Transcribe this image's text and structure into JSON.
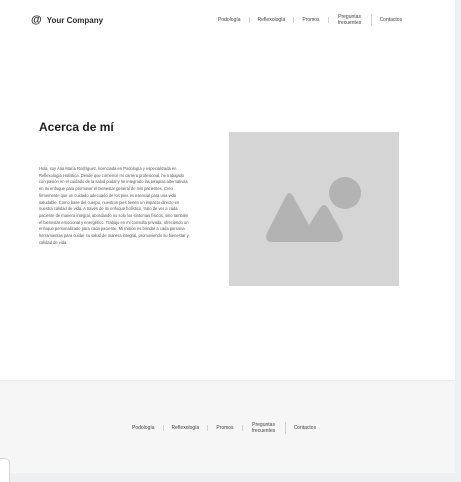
{
  "header": {
    "logo_icon": "@",
    "logo_text": "Your Company",
    "nav": [
      "Podología",
      "Reflexología",
      "Promos",
      "Preguntas frecuentes",
      "Contactos"
    ]
  },
  "main": {
    "title": "Acerca de mí",
    "body": "Hola, soy Ana María Rodríguez, licenciada en Podología y especializada en Reflexología Holística. Desde que comencé mi carrera profesional, he trabajado con pasión en el cuidado de la salud podal y he integrado las terapias alternativas en mi enfoque para promover el bienestar general de mis pacientes. Creo firmemente que un cuidado adecuado de los pies es esencial para una vida saludable. Como base del cuerpo, nuestros pies tienen un impacto directo en nuestra calidad de vida. A través de mi enfoque holístico, trato de ver a cada paciente de manera integral, abordando no solo los síntomas físicos, sino también el bienestar emocional y energético. Trabajo en mi consulta privada, ofreciendo un enfoque personalizado para cada paciente. Mi misión es brindar a cada persona herramientas para cuidar su salud de manera integral, promoviendo su bienestar y calidad de vida.",
    "image_icon": "image-placeholder-icon"
  },
  "footer": {
    "nav": [
      "Podología",
      "Reflexología",
      "Promos",
      "Preguntas frecuentes",
      "Contactos"
    ]
  },
  "colors": {
    "placeholder_bg": "#d5d5d5",
    "placeholder_shape": "#b3b3b3",
    "footer_bg": "#f6f6f6"
  }
}
